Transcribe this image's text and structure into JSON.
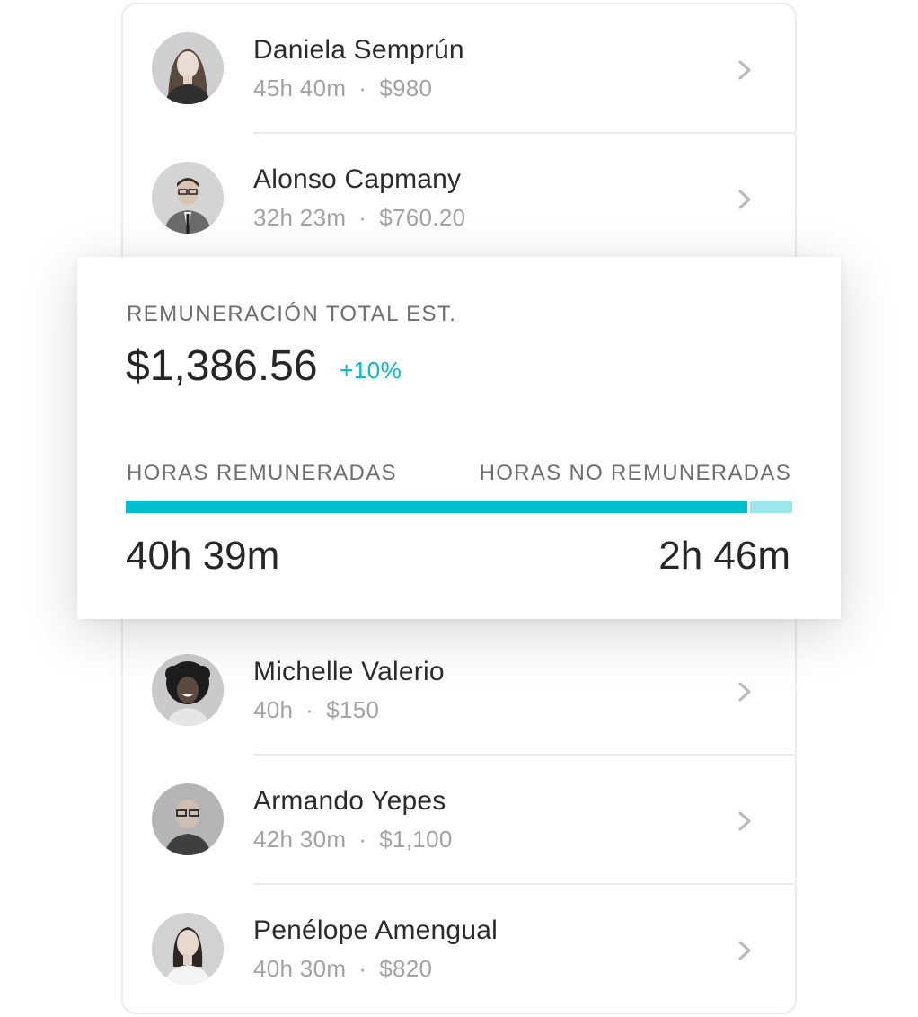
{
  "employees": [
    {
      "name": "Daniela Semprún",
      "hours": "45h 40m",
      "separator": "·",
      "pay": "$980"
    },
    {
      "name": "Alonso Capmany",
      "hours": "32h 23m",
      "separator": "·",
      "pay": "$760.20"
    },
    {
      "name": "Michelle Valerio",
      "hours": "40h",
      "separator": "·",
      "pay": "$150"
    },
    {
      "name": "Armando Yepes",
      "hours": "42h 30m",
      "separator": "·",
      "pay": "$1,100"
    },
    {
      "name": "Penélope Amengual",
      "hours": "40h 30m",
      "separator": "·",
      "pay": "$820"
    }
  ],
  "summary": {
    "label": "REMUNERACIÓN TOTAL EST.",
    "total": "$1,386.56",
    "change": "+10%",
    "paid_label": "HORAS REMUNERADAS",
    "unpaid_label": "HORAS NO REMUNERADAS",
    "paid_value": "40h 39m",
    "unpaid_value": "2h 46m",
    "paid_fraction": 0.936
  },
  "colors": {
    "accent": "#00bcd0",
    "bar_paid": "#00bfcf",
    "bar_unpaid": "#9be6ec",
    "text_primary": "#2b2b2b",
    "text_secondary": "#a3a3a3"
  },
  "icons": {
    "row_chevron": "chevron-right-icon",
    "avatar": "avatar-photo"
  }
}
